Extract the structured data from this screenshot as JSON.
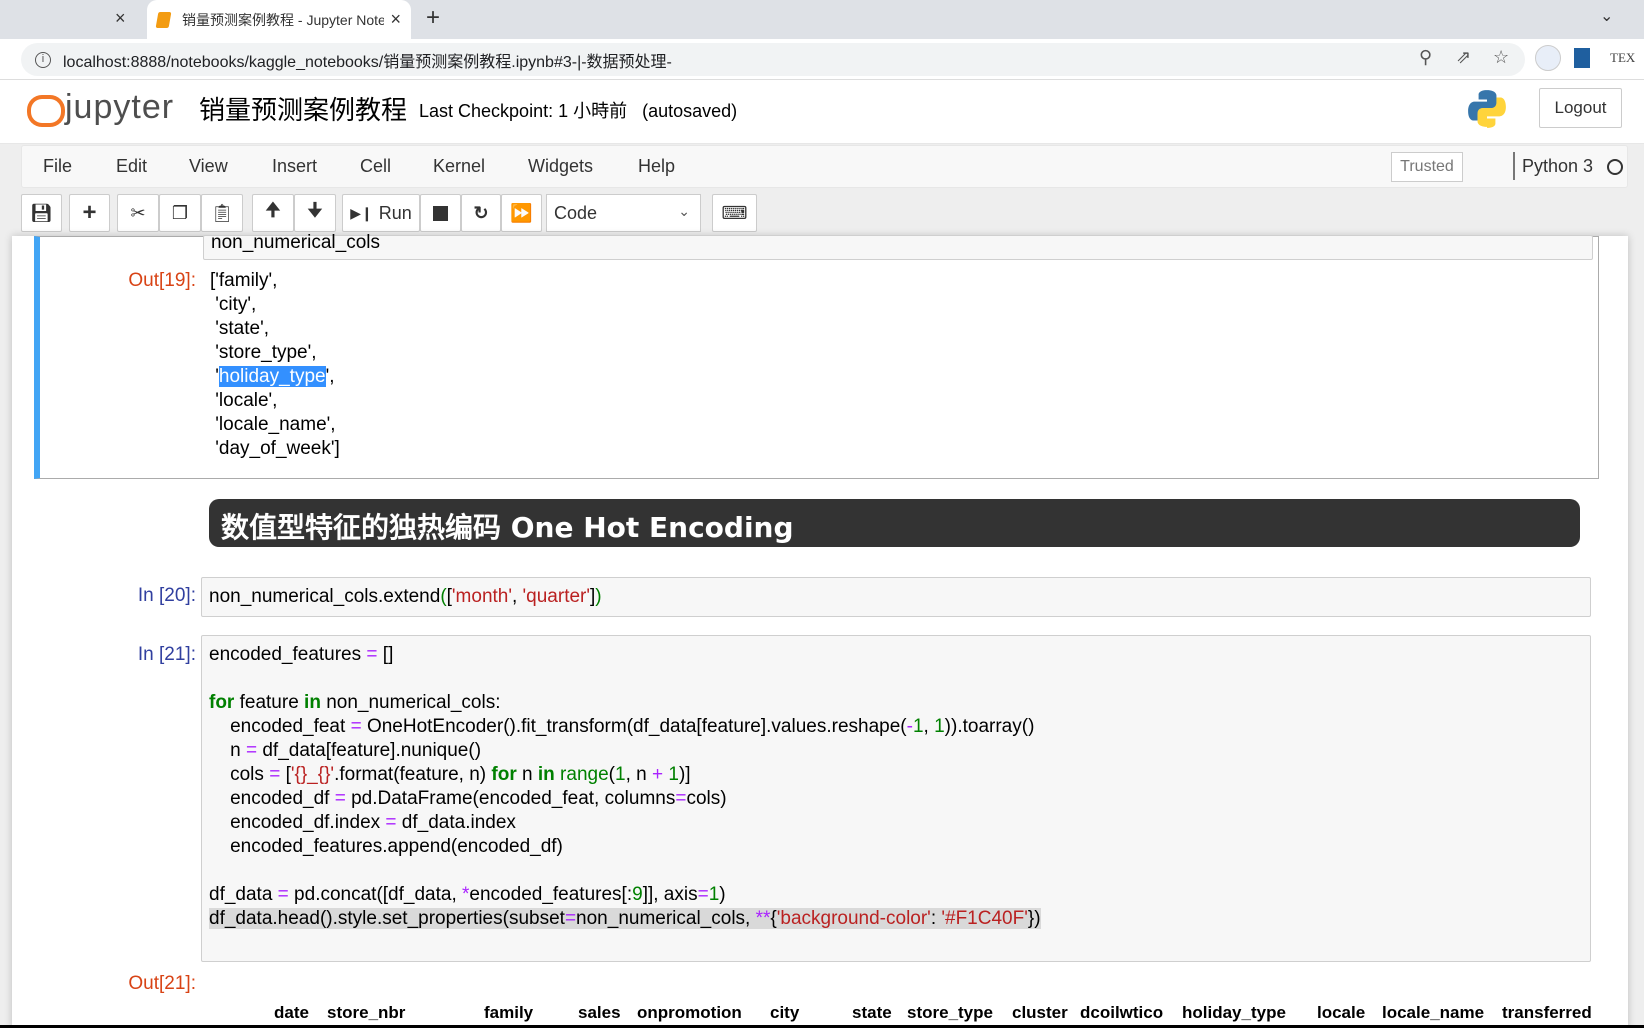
{
  "browser": {
    "active_tab_title": "销量预测案例教程 - Jupyter Notebook",
    "url": "localhost:8888/notebooks/kaggle_notebooks/销量预测案例教程.ipynb#3-|-数据预处理-",
    "new_tab": "+",
    "close": "×",
    "ext_tex": "TEX"
  },
  "header": {
    "logo_text": "jupyter",
    "notebook_title": "销量预测案例教程",
    "checkpoint": "Last Checkpoint: 1 小時前   (autosaved)",
    "logout": "Logout"
  },
  "menu": {
    "items": [
      "File",
      "Edit",
      "View",
      "Insert",
      "Cell",
      "Kernel",
      "Widgets",
      "Help"
    ],
    "trusted": "Trusted",
    "kernel": "Python 3"
  },
  "toolbar": {
    "run": "Run",
    "cell_type": "Code"
  },
  "cells": {
    "c19": {
      "input_tail": "non_numerical_cols",
      "out_prompt": "Out[19]:",
      "output_lines": [
        "['family',",
        " 'city',",
        " 'state',",
        " 'store_type',",
        " 'holiday_type',",
        " 'locale',",
        " 'locale_name',",
        " 'day_of_week']"
      ]
    },
    "md": {
      "heading": "数值型特征的独热编码 One Hot Encoding"
    },
    "c20": {
      "prompt": "In [20]:"
    },
    "c21": {
      "prompt": "In [21]:",
      "out_prompt": "Out[21]:",
      "table_headers": [
        "date",
        "store_nbr",
        "family",
        "sales",
        "onpromotion",
        "city",
        "state",
        "store_type",
        "cluster",
        "dcoilwtico",
        "holiday_type",
        "locale",
        "locale_name",
        "transferred"
      ]
    }
  },
  "code20": [
    [
      [
        "non_numerical_cols.extend",
        ""
      ],
      [
        "(",
        "nm"
      ],
      [
        "[",
        ""
      ],
      [
        "'month'",
        "st"
      ],
      [
        ", ",
        ""
      ],
      [
        "'quarter'",
        "st"
      ],
      [
        "]",
        ""
      ],
      [
        ")",
        "nm"
      ]
    ]
  ],
  "code21": [
    [
      [
        "encoded_features ",
        ""
      ],
      [
        "=",
        "op"
      ],
      [
        " []",
        ""
      ]
    ],
    [],
    [
      [
        "for",
        "kw"
      ],
      [
        " feature ",
        ""
      ],
      [
        "in",
        "kw"
      ],
      [
        " non_numerical_cols:",
        ""
      ]
    ],
    [
      [
        "    encoded_feat ",
        ""
      ],
      [
        "=",
        "op"
      ],
      [
        " OneHotEncoder().fit_transform(df_data[feature].values.reshape(",
        ""
      ],
      [
        "-",
        "op"
      ],
      [
        "1",
        "nm"
      ],
      [
        ", ",
        ""
      ],
      [
        "1",
        "nm"
      ],
      [
        ")).toarray()",
        ""
      ]
    ],
    [
      [
        "    n ",
        ""
      ],
      [
        "=",
        "op"
      ],
      [
        " df_data[feature].nunique()",
        ""
      ]
    ],
    [
      [
        "    cols ",
        ""
      ],
      [
        "=",
        "op"
      ],
      [
        " [",
        ""
      ],
      [
        "'{}_{}'",
        "st"
      ],
      [
        ".format(feature, n) ",
        ""
      ],
      [
        "for",
        "kw"
      ],
      [
        " n ",
        ""
      ],
      [
        "in",
        "kw"
      ],
      [
        " ",
        ""
      ],
      [
        "range",
        "bi"
      ],
      [
        "(",
        ""
      ],
      [
        "1",
        "nm"
      ],
      [
        ", n ",
        ""
      ],
      [
        "+",
        "op"
      ],
      [
        " ",
        ""
      ],
      [
        "1",
        "nm"
      ],
      [
        ")]",
        ""
      ]
    ],
    [
      [
        "    encoded_df ",
        ""
      ],
      [
        "=",
        "op"
      ],
      [
        " pd.DataFrame(encoded_feat, columns",
        ""
      ],
      [
        "=",
        "op"
      ],
      [
        "cols)",
        ""
      ]
    ],
    [
      [
        "    encoded_df.index ",
        ""
      ],
      [
        "=",
        "op"
      ],
      [
        " df_data.index",
        ""
      ]
    ],
    [
      [
        "    encoded_features.append(encoded_df)",
        ""
      ]
    ],
    [],
    [
      [
        "df_data ",
        ""
      ],
      [
        "=",
        "op"
      ],
      [
        " pd.concat([df_data, ",
        ""
      ],
      [
        "*",
        "op"
      ],
      [
        "encoded_features[:",
        ""
      ],
      [
        "9",
        "nm"
      ],
      [
        "]], axis",
        ""
      ],
      [
        "=",
        "op"
      ],
      [
        "1",
        "nm"
      ],
      [
        ")",
        ""
      ]
    ],
    [
      [
        "df_data.head().style.set_properties(subset",
        ""
      ],
      [
        "=",
        "op"
      ],
      [
        "non_numerical_cols, ",
        ""
      ],
      [
        "**",
        "op"
      ],
      [
        "{",
        ""
      ],
      [
        "'background-color'",
        "st"
      ],
      [
        ": ",
        ""
      ],
      [
        "'#F1C40F'",
        "st"
      ],
      [
        "})",
        ""
      ]
    ]
  ],
  "colors": {
    "selected_cell_border": "#42A5F5",
    "in_prompt": "#303F9F",
    "out_prompt": "#D84315",
    "accent": "#F37726"
  }
}
